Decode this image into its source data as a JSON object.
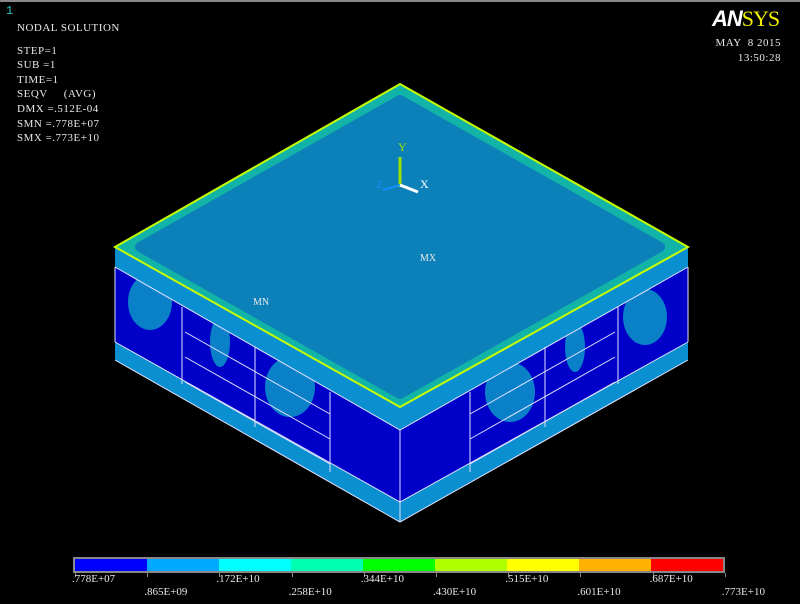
{
  "window_number": "1",
  "info": {
    "title": "NODAL SOLUTION",
    "lines": [
      "STEP=1",
      "SUB =1",
      "TIME=1",
      "SEQV     (AVG)",
      "DMX =.512E-04",
      "SMN =.778E+07",
      "SMX =.773E+10"
    ]
  },
  "logo": {
    "part1": "AN",
    "part2": "SYS"
  },
  "date": "MAY  8 2015",
  "time": "13:50:28",
  "triad": {
    "y": "Y",
    "z": "Z",
    "x": "X"
  },
  "markers": {
    "min": "MN",
    "max": "MX"
  },
  "legend": {
    "colors": [
      "#0000ff",
      "#00a8ff",
      "#00ffff",
      "#00ffb0",
      "#00ff00",
      "#b0ff00",
      "#ffff00",
      "#ffb000",
      "#ff0000"
    ],
    "labels": [
      ".778E+07",
      ".865E+09",
      ".172E+10",
      ".258E+10",
      ".344E+10",
      ".430E+10",
      ".515E+10",
      ".601E+10",
      ".687E+10",
      ".773E+10"
    ]
  }
}
